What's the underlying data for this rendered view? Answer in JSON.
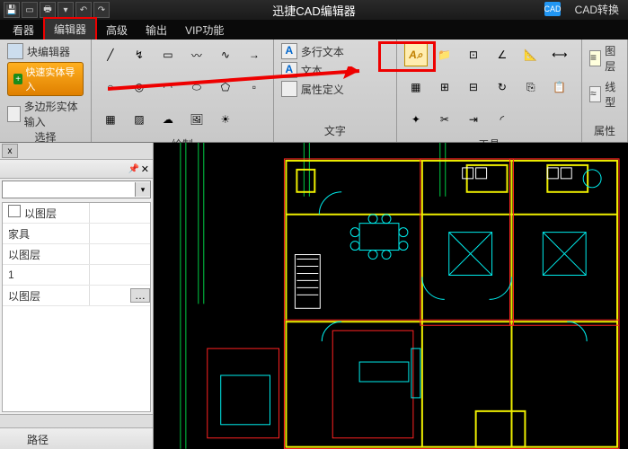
{
  "title": "迅捷CAD编辑器",
  "cad_badge": "CAD",
  "cad_convert": "CAD转换",
  "menu": {
    "viewer": "看器",
    "editor": "编辑器",
    "advanced": "高级",
    "output": "输出",
    "vip": "VIP功能"
  },
  "ribbon": {
    "select": {
      "label": "选择",
      "block_editor": "块编辑器",
      "fast_import": "快速实体导入",
      "poly_input": "多边形实体输入"
    },
    "draw": {
      "label": "绘制"
    },
    "text": {
      "label": "文字",
      "mtext": "多行文本",
      "text": "文本",
      "attrdef": "属性定义"
    },
    "tools": {
      "label": "工具"
    },
    "props": {
      "label": "属性",
      "layer": "图层",
      "linetype": "线型"
    }
  },
  "panel": {
    "by_layer": "以图层",
    "furniture": "家具",
    "one": "1",
    "path": "路径",
    "close": "x",
    "pin": "📌"
  },
  "icons": {
    "mtext": "A",
    "text": "A",
    "attr": "A",
    "find": "A"
  }
}
